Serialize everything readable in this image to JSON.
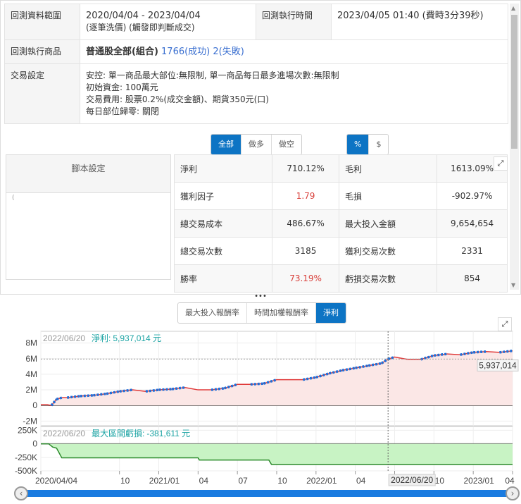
{
  "info": {
    "range_label": "回測資料範圍",
    "range_value": "2020/04/04 - 2023/04/04",
    "range_note": "(逐筆洗價) (觸發即判斷成交)",
    "time_label": "回測執行時間",
    "time_value": "2023/04/05 01:40 (費時3分39秒)",
    "product_label": "回測執行商品",
    "product_value": "普通股全部(組合)",
    "product_success": "1766(成功)",
    "product_fail": "2(失敗)",
    "trade_label": "交易設定",
    "trade_lines": [
      "安控: 單一商品最大部位:無限制, 單一商品每日最多進場次數:無限制",
      "初始資金: 100萬元",
      "交易費用: 股票0.2%(成交金額)、期貨350元(口)",
      "每日部位歸零: 關閉"
    ]
  },
  "direction_tabs": [
    "全部",
    "做多",
    "做空"
  ],
  "unit_tabs": [
    "%",
    "$"
  ],
  "script_header": "腳本設定",
  "script_body": "(",
  "stats": [
    [
      "淨利",
      "710.12%",
      "毛利",
      "1613.09%"
    ],
    [
      "獲利因子",
      "1.79",
      "毛損",
      "-902.97%"
    ],
    [
      "總交易成本",
      "486.67%",
      "最大投入金額",
      "9,654,654"
    ],
    [
      "總交易次數",
      "3185",
      "獲利交易次數",
      "2331"
    ],
    [
      "勝率",
      "73.19%",
      "虧損交易次數",
      "854"
    ]
  ],
  "chart_tabs": [
    "最大投入報酬率",
    "時間加權報酬率",
    "淨利"
  ],
  "colors": {
    "accent": "#0d74c4",
    "red": "#d9413c",
    "teal": "#1aa3a3"
  },
  "chart_data": {
    "type": "line",
    "x_ticks": [
      "2020/04/04",
      "10",
      "2021/01",
      "04",
      "07",
      "10",
      "2022/01",
      "04",
      "07",
      "10",
      "2023/01",
      "04"
    ],
    "x_tick_months": [
      0,
      6,
      9,
      12,
      15,
      18,
      21,
      24,
      27,
      30,
      33,
      36
    ],
    "crosshair": {
      "date": "2022/06/20",
      "month": 26.5
    },
    "top": {
      "legend_date": "2022/06/20",
      "legend_label": "淨利:",
      "legend_value": "5,937,014 元",
      "crosshair_value": "5,937,014",
      "y_ticks": [
        "8M",
        "6M",
        "4M",
        "2M",
        "0",
        "-2M"
      ],
      "ylim": [
        -2.6,
        9.5
      ],
      "y_tick_values": [
        8,
        6,
        4,
        2,
        0,
        -2
      ],
      "series_month": [
        0,
        0.5,
        0.8,
        1.2,
        1.6,
        2,
        3,
        4,
        5,
        6,
        7,
        8,
        9,
        10,
        11,
        12,
        13,
        14,
        15,
        16,
        17,
        18,
        19,
        20,
        21,
        22,
        23,
        24,
        25,
        26,
        26.5,
        27,
        28,
        29,
        30,
        31,
        32,
        33,
        34,
        35,
        36
      ],
      "series_value": [
        0.1,
        0.1,
        0,
        0.8,
        1.0,
        1.0,
        1.2,
        1.3,
        1.5,
        1.8,
        2.0,
        1.8,
        2.0,
        2.1,
        2.3,
        2.0,
        2.0,
        2.2,
        2.7,
        2.7,
        2.8,
        3.3,
        3.3,
        3.3,
        3.6,
        4.1,
        4.5,
        4.8,
        5.1,
        5.4,
        5.94,
        6.2,
        5.9,
        5.9,
        6.4,
        6.6,
        6.5,
        6.8,
        6.9,
        6.8,
        7.0
      ]
    },
    "bottom": {
      "legend_date": "2022/06/20",
      "legend_label": "最大區間虧損:",
      "legend_value": "-381,611 元",
      "y_ticks": [
        "250K",
        "0",
        "-250K",
        "-500K"
      ],
      "y_tick_values": [
        250,
        0,
        -250,
        -500
      ],
      "ylim": [
        -500,
        320
      ],
      "series_month": [
        0,
        0.6,
        0.9,
        1.2,
        1.6,
        12,
        12.1,
        17.4,
        17.6,
        36
      ],
      "series_value": [
        0,
        0,
        -60,
        -80,
        -260,
        -260,
        -300,
        -300,
        -382,
        -382
      ]
    }
  }
}
